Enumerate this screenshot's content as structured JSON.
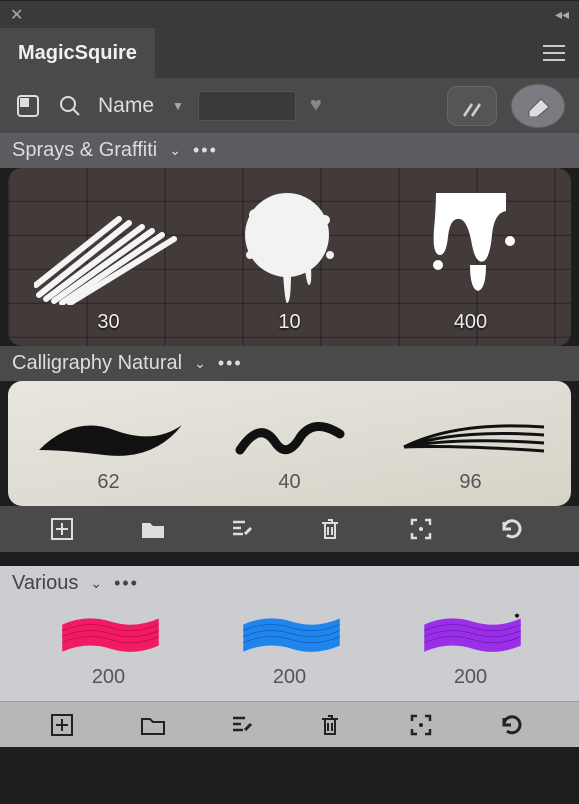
{
  "app": {
    "name": "MagicSquire"
  },
  "toolbar": {
    "sort_label": "Name"
  },
  "groups": [
    {
      "name": "Sprays & Graffiti",
      "style": "bricks",
      "brushes": [
        {
          "size": "30",
          "shape": "spray-stroke"
        },
        {
          "size": "10",
          "shape": "splat"
        },
        {
          "size": "400",
          "shape": "drip"
        }
      ]
    },
    {
      "name": "Calligraphy Natural",
      "style": "paper",
      "brushes": [
        {
          "size": "62",
          "shape": "callig-wave"
        },
        {
          "size": "40",
          "shape": "callig-squiggle"
        },
        {
          "size": "96",
          "shape": "callig-lines"
        }
      ]
    },
    {
      "name": "Various",
      "style": "swatches",
      "brushes": [
        {
          "size": "200",
          "color": "#f01b63"
        },
        {
          "size": "200",
          "color": "#1f85ec"
        },
        {
          "size": "200",
          "color": "#9a2fe8"
        }
      ]
    }
  ]
}
